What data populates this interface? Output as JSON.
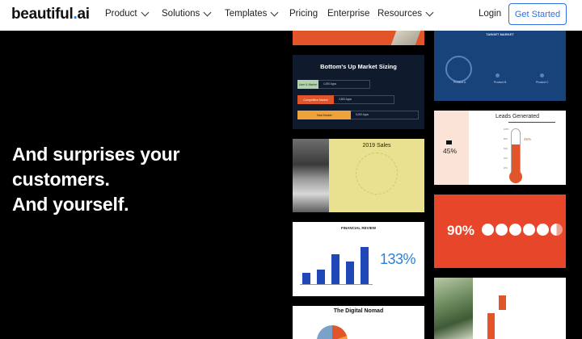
{
  "nav": {
    "logo_main": "beautiful",
    "logo_dot": ".",
    "logo_tail": "ai",
    "items": [
      {
        "label": "Product",
        "dropdown": true
      },
      {
        "label": "Solutions",
        "dropdown": true
      },
      {
        "label": "Templates",
        "dropdown": true
      },
      {
        "label": "Pricing",
        "dropdown": false
      },
      {
        "label": "Enterprise",
        "dropdown": false
      },
      {
        "label": "Resources",
        "dropdown": true
      }
    ],
    "login": "Login",
    "cta": "Get Started"
  },
  "hero": {
    "lines": [
      "And surprises your",
      "customers.",
      "And yourself."
    ]
  },
  "tiles": {
    "market": {
      "title": "Bottom's Up Market Sizing",
      "bars": [
        {
          "label": "User & Market",
          "desc": "1,000 Apps"
        },
        {
          "label": "Competitive Market",
          "desc": "2,500 Apps"
        },
        {
          "label": "Total Market",
          "desc": "5,000 Apps"
        }
      ]
    },
    "target": {
      "title": "TARGET MARKET",
      "labels": [
        "Product A",
        "Product B",
        "Product C"
      ]
    },
    "sales": {
      "title": "2019 Sales"
    },
    "leads": {
      "title": "Leads Generated",
      "pct": "45%",
      "callout": "45%",
      "ticks": [
        "100%",
        "80%",
        "60%",
        "40%",
        "20%"
      ]
    },
    "financial": {
      "title": "FINANCIAL REVIEW",
      "big": "133%",
      "bar_values": [
        30,
        40,
        80,
        60,
        100
      ]
    },
    "ninety": {
      "big": "90%",
      "circles": 6
    },
    "nomad": {
      "title": "The Digital Nomad"
    }
  },
  "colors": {
    "accent": "#2f6fe0",
    "orange": "#e2552b",
    "navy": "#0f1b2d",
    "blue": "#18427a"
  }
}
